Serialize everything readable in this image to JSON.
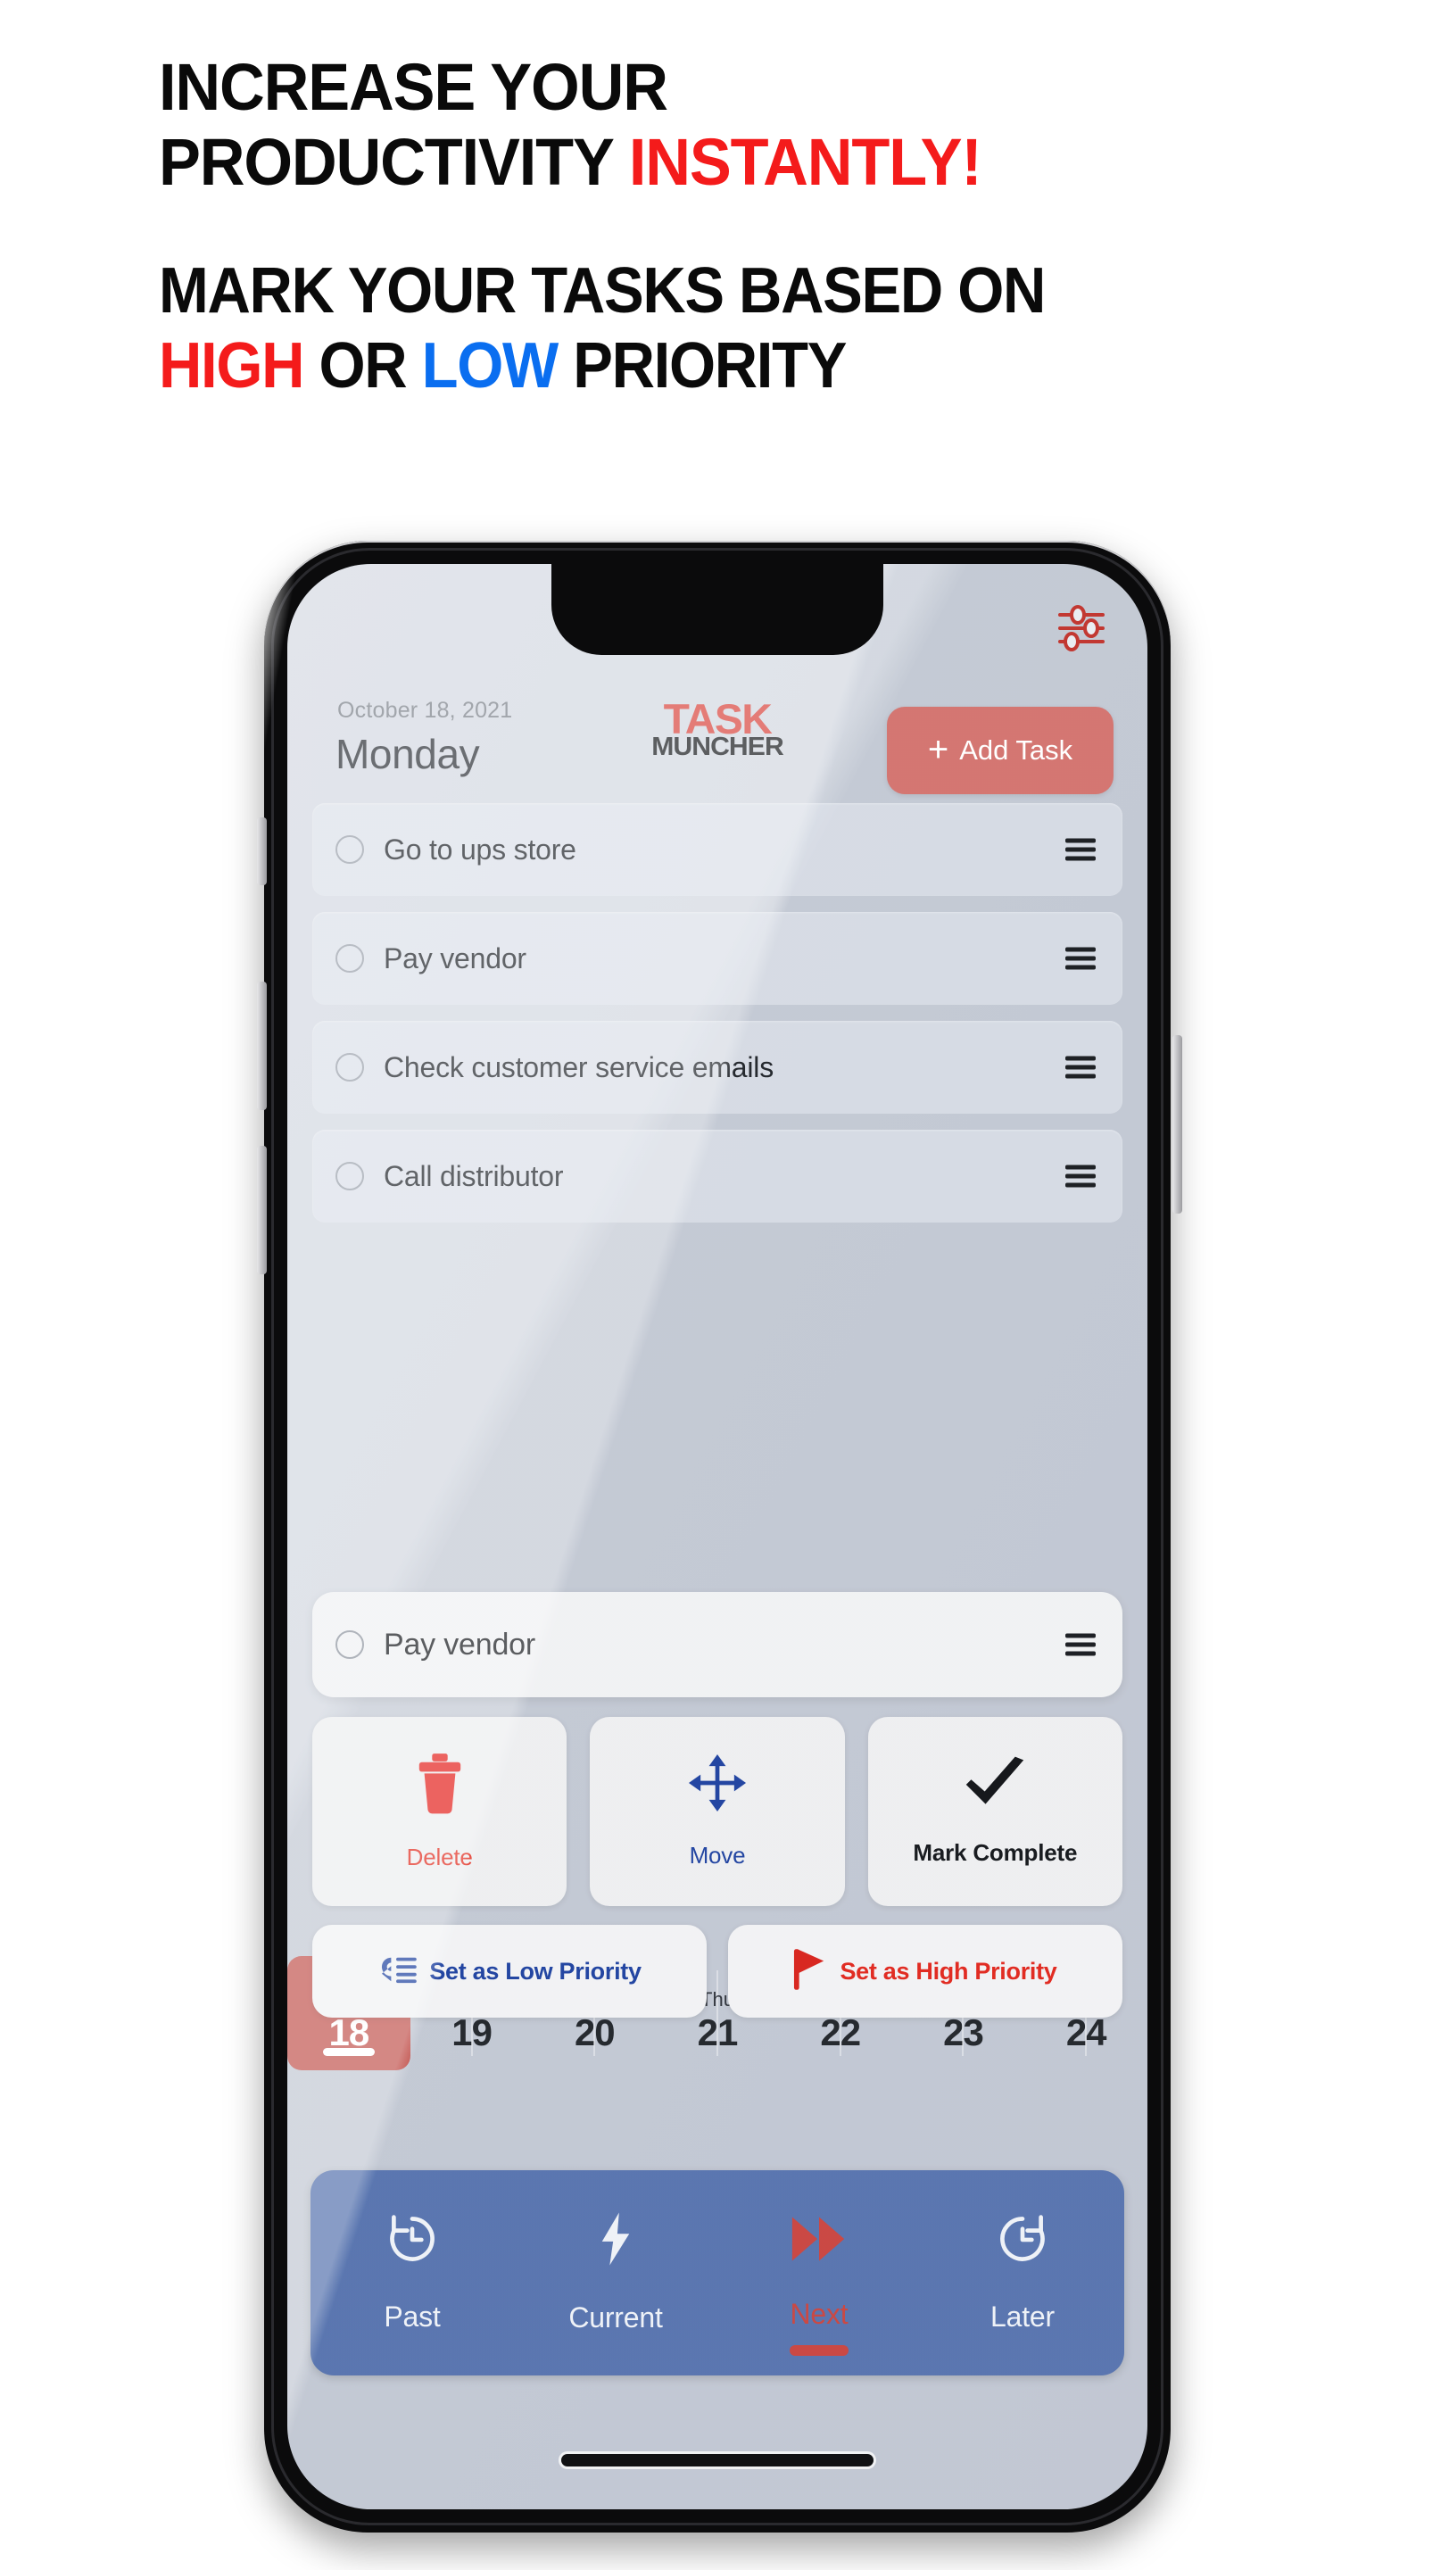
{
  "marketing": {
    "headline1": {
      "l1": "INCREASE YOUR",
      "l2a": "PRODUCTIVITY ",
      "l2b": "INSTANTLY",
      "l2c": "!"
    },
    "headline2": {
      "l1": "MARK YOUR TASKS BASED ON",
      "l2a": "HIGH",
      "l2b": " OR ",
      "l2c": "LOW",
      "l2d": " PRIORITY"
    }
  },
  "colors": {
    "accent_red": "#f41b1b",
    "accent_blue": "#0a6ef0",
    "brand_red": "#d8443c",
    "nav_blue": "#5471ad",
    "active_day": "#c2544f"
  },
  "app": {
    "header": {
      "date": "October 18, 2021",
      "day": "Monday",
      "logo_top": "TASK",
      "logo_bottom": "MUNCHER",
      "add_task_label": "Add Task",
      "add_task_plus": "+",
      "filter_icon": "sliders-icon"
    },
    "tasks": [
      {
        "label": "Go to ups store"
      },
      {
        "label": "Pay vendor"
      },
      {
        "label": "Check customer service emails"
      },
      {
        "label": "Call distributor"
      }
    ],
    "selected_task": {
      "label": "Pay vendor"
    },
    "actions": [
      {
        "label": "Delete",
        "icon": "trash-icon",
        "style": "del"
      },
      {
        "label": "Move",
        "icon": "move-arrows-icon",
        "style": "mov"
      },
      {
        "label": "Mark Complete",
        "icon": "check-icon",
        "style": "cmp"
      }
    ],
    "priority": [
      {
        "label": "Set as Low Priority",
        "icon": "low-priority-icon",
        "style": "low"
      },
      {
        "label": "Set as High Priority",
        "icon": "flag-icon",
        "style": "high"
      }
    ],
    "calendar": {
      "days": [
        {
          "num": "18",
          "dow": "",
          "active": true
        },
        {
          "num": "19",
          "dow": "",
          "active": false
        },
        {
          "num": "20",
          "dow": "",
          "active": false
        },
        {
          "num": "21",
          "dow": "Thu",
          "active": false
        },
        {
          "num": "22",
          "dow": "",
          "active": false
        },
        {
          "num": "23",
          "dow": "",
          "active": false
        },
        {
          "num": "24",
          "dow": "",
          "active": false
        }
      ]
    },
    "bottom_nav": [
      {
        "label": "Past",
        "icon": "clock-back-icon",
        "active": false
      },
      {
        "label": "Current",
        "icon": "lightning-icon",
        "active": false
      },
      {
        "label": "Next",
        "icon": "fast-forward-icon",
        "active": true
      },
      {
        "label": "Later",
        "icon": "clock-refresh-icon",
        "active": false
      }
    ]
  }
}
